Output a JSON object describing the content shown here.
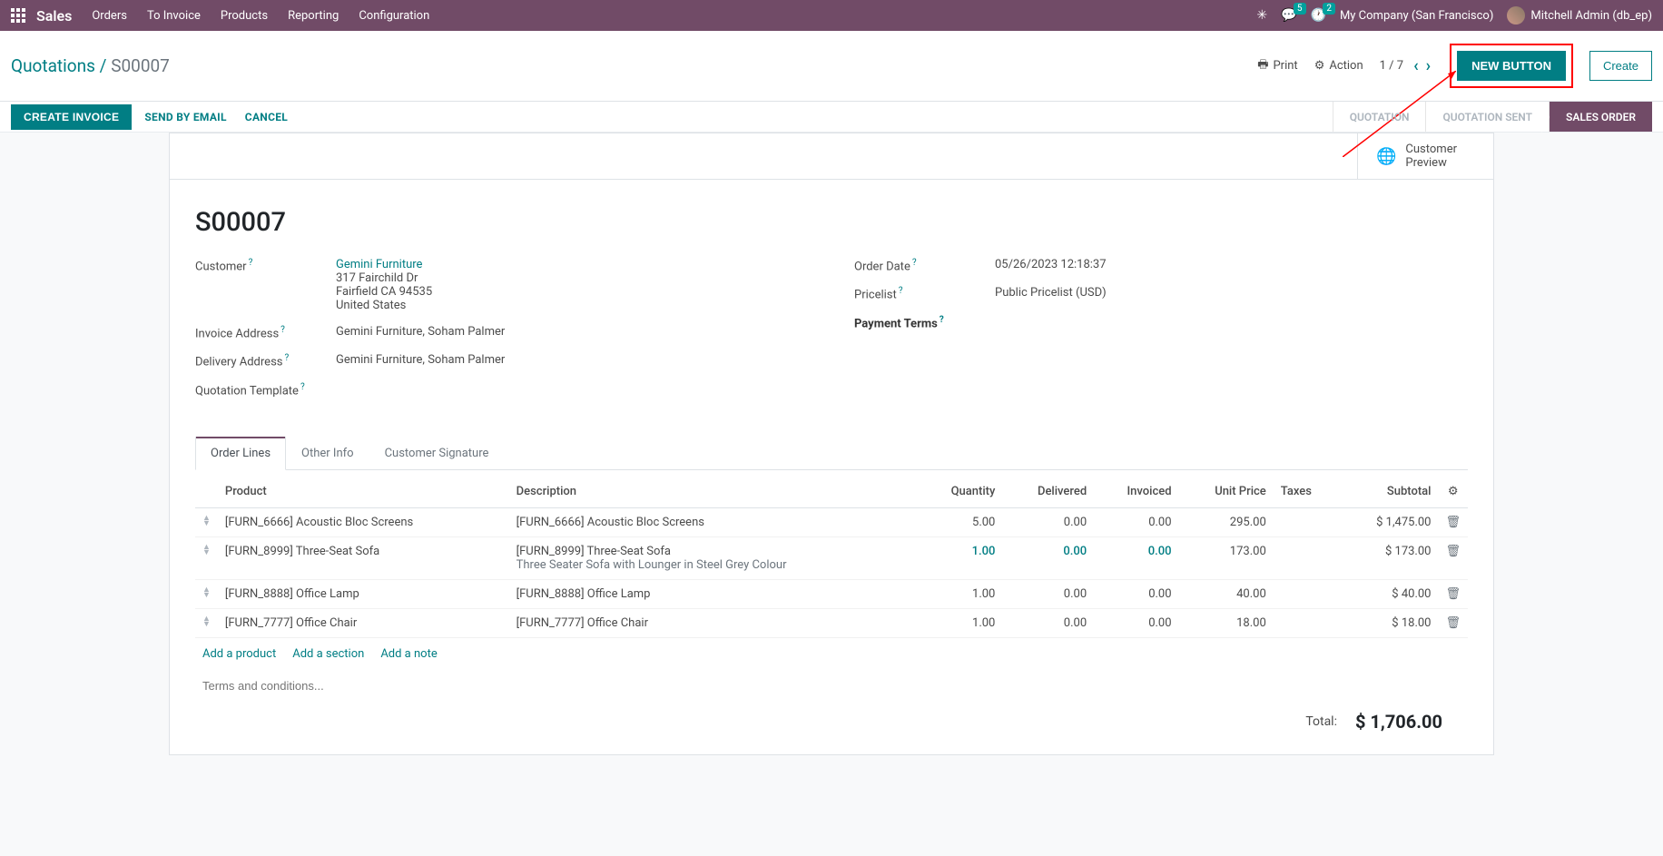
{
  "nav": {
    "brand": "Sales",
    "menu": [
      "Orders",
      "To Invoice",
      "Products",
      "Reporting",
      "Configuration"
    ],
    "msg_count": "5",
    "activity_count": "2",
    "company": "My Company (San Francisco)",
    "user": "Mitchell Admin (db_ep)"
  },
  "breadcrumb": {
    "root": "Quotations",
    "current": "S00007"
  },
  "controls": {
    "print": "Print",
    "action": "Action",
    "pager": "1 / 7",
    "new_button": "NEW BUTTON",
    "create": "Create"
  },
  "actions": {
    "create_invoice": "CREATE INVOICE",
    "send_email": "SEND BY EMAIL",
    "cancel": "CANCEL"
  },
  "stages": [
    "QUOTATION",
    "QUOTATION SENT",
    "SALES ORDER"
  ],
  "statbtn": {
    "preview": "Customer\nPreview"
  },
  "record": {
    "name": "S00007",
    "labels": {
      "customer": "Customer",
      "invoice_addr": "Invoice Address",
      "delivery_addr": "Delivery Address",
      "quote_tmpl": "Quotation Template",
      "order_date": "Order Date",
      "pricelist": "Pricelist",
      "payment_terms": "Payment Terms"
    },
    "customer_name": "Gemini Furniture",
    "customer_addr1": "317 Fairchild Dr",
    "customer_addr2": "Fairfield CA 94535",
    "customer_addr3": "United States",
    "invoice_addr": "Gemini Furniture, Soham Palmer",
    "delivery_addr": "Gemini Furniture, Soham Palmer",
    "order_date": "05/26/2023 12:18:37",
    "pricelist": "Public Pricelist (USD)"
  },
  "tabs": [
    "Order Lines",
    "Other Info",
    "Customer Signature"
  ],
  "cols": {
    "product": "Product",
    "desc": "Description",
    "qty": "Quantity",
    "delivered": "Delivered",
    "invoiced": "Invoiced",
    "price": "Unit Price",
    "taxes": "Taxes",
    "subtotal": "Subtotal"
  },
  "lines": [
    {
      "product": "[FURN_6666] Acoustic Bloc Screens",
      "desc": "[FURN_6666] Acoustic Bloc Screens",
      "sub": "",
      "qty": "5.00",
      "del": "0.00",
      "inv": "0.00",
      "price": "295.00",
      "subtotal": "$ 1,475.00",
      "blue": false
    },
    {
      "product": "[FURN_8999] Three-Seat Sofa",
      "desc": "[FURN_8999] Three-Seat Sofa",
      "sub": "Three Seater Sofa with Lounger in Steel Grey Colour",
      "qty": "1.00",
      "del": "0.00",
      "inv": "0.00",
      "price": "173.00",
      "subtotal": "$ 173.00",
      "blue": true
    },
    {
      "product": "[FURN_8888] Office Lamp",
      "desc": "[FURN_8888] Office Lamp",
      "sub": "",
      "qty": "1.00",
      "del": "0.00",
      "inv": "0.00",
      "price": "40.00",
      "subtotal": "$ 40.00",
      "blue": false
    },
    {
      "product": "[FURN_7777] Office Chair",
      "desc": "[FURN_7777] Office Chair",
      "sub": "",
      "qty": "1.00",
      "del": "0.00",
      "inv": "0.00",
      "price": "18.00",
      "subtotal": "$ 18.00",
      "blue": false
    }
  ],
  "add": {
    "product": "Add a product",
    "section": "Add a section",
    "note": "Add a note"
  },
  "terms_placeholder": "Terms and conditions...",
  "totals": {
    "label": "Total:",
    "amount": "$ 1,706.00"
  }
}
